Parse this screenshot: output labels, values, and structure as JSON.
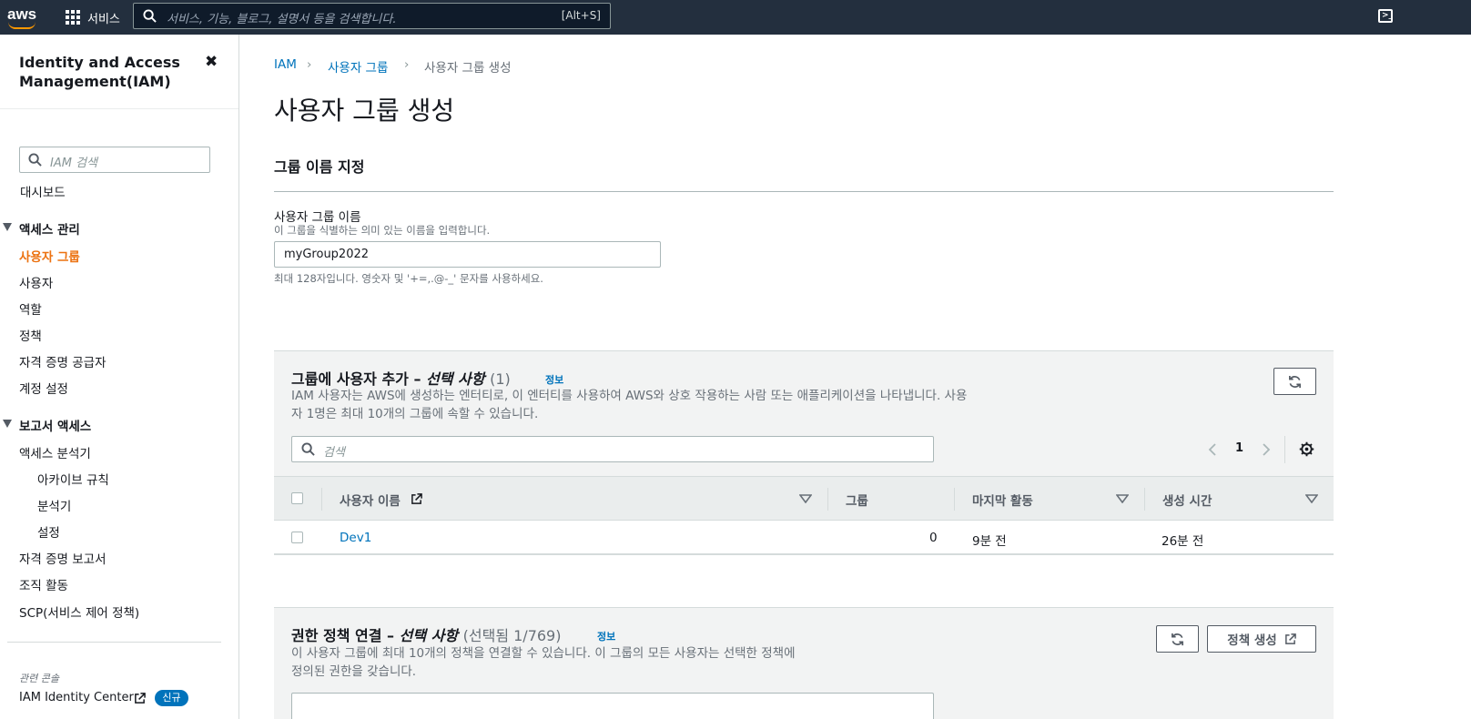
{
  "topnav": {
    "logo": "aws",
    "services_label": "서비스",
    "search_placeholder": "서비스, 기능, 블로그, 설명서 등을 검색합니다.",
    "search_shortcut": "[Alt+S]",
    "cloudshell_icon": "terminal-icon"
  },
  "sidebar": {
    "title": "Identity and Access Management(IAM)",
    "close_glyph": "✖",
    "search_placeholder": "IAM 검색",
    "dashboard": "대시보드",
    "access_management": {
      "heading": "액세스 관리",
      "items": [
        "사용자 그룹",
        "사용자",
        "역할",
        "정책",
        "자격 증명 공급자",
        "계정 설정"
      ]
    },
    "report_access": {
      "heading": "보고서 액세스",
      "items": [
        "액세스 분석기",
        "아카이브 규칙",
        "분석기",
        "설정",
        "자격 증명 보고서",
        "조직 활동",
        "SCP(서비스 제어 정책)"
      ]
    },
    "related_label": "관련 콘솔",
    "identity_center": "IAM Identity Center",
    "new_badge": "신규",
    "active_color": "#ec7211"
  },
  "breadcrumb": {
    "items": [
      "IAM",
      "사용자 그룹",
      "사용자 그룹 생성"
    ],
    "separator": "›"
  },
  "page": {
    "title": "사용자 그룹 생성"
  },
  "name_section": {
    "title": "그룹 이름 지정",
    "label": "사용자 그룹 이름",
    "description": "이 그룹을 식별하는 의미 있는 이름을 입력합니다.",
    "value": "myGroup2022",
    "constraint": "최대 128자입니다. 영숫자 및 '+=,.@-_' 문자를 사용하세요."
  },
  "users_panel": {
    "title_main": "그룹에 사용자 추가 – ",
    "title_optional": "선택 사항",
    "count": "(1)",
    "info": "정보",
    "description": "IAM 사용자는 AWS에 생성하는 엔터티로, 이 엔터티를 사용하여 AWS와 상호 작용하는 사람 또는 애플리케이션을 나타냅니다. 사용자 1명은 최대 10개의 그룹에 속할 수 있습니다.",
    "search_placeholder": "검색",
    "page_number": "1",
    "columns": [
      "사용자 이름",
      "그룹",
      "마지막 활동",
      "생성 시간"
    ],
    "rows": [
      {
        "name": "Dev1",
        "groups": "0",
        "last_activity": "9분 전",
        "created": "26분 전"
      }
    ]
  },
  "policy_panel": {
    "title_main": "권한 정책 연결 – ",
    "title_optional": "선택 사항",
    "count": "(선택됨 1/769)",
    "info": "정보",
    "description": "이 사용자 그룹에 최대 10개의 정책을 연결할 수 있습니다. 이 그룹의 모든 사용자는 선택한 정책에 정의된 권한을 갖습니다.",
    "create_policy_label": "정책 생성"
  }
}
